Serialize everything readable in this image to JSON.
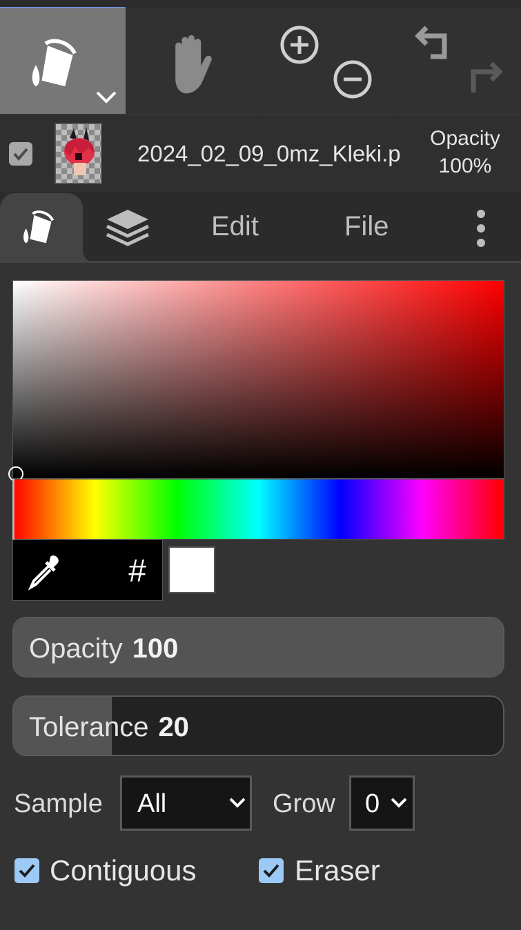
{
  "toolbar": {
    "active_tool": "fill-tool",
    "tools": [
      "fill",
      "hand",
      "zoom",
      "undo-redo"
    ]
  },
  "layer": {
    "visible": true,
    "name": "2024_02_09_0mz_Kleki.p",
    "opacity_label": "Opacity",
    "opacity_value": "100%"
  },
  "tabs": {
    "active": "fill",
    "edit_label": "Edit",
    "file_label": "File"
  },
  "color_picker": {
    "hue_color": "#ff0000",
    "current_color": "#ffffff",
    "hex_label": "#"
  },
  "fill_settings": {
    "opacity_label": "Opacity",
    "opacity_value": "100",
    "opacity_fraction": 1.0,
    "tolerance_label": "Tolerance",
    "tolerance_value": "20",
    "tolerance_fraction": 0.2,
    "sample_label": "Sample",
    "sample_value": "All",
    "grow_label": "Grow",
    "grow_value": "0",
    "contiguous_label": "Contiguous",
    "contiguous_checked": true,
    "eraser_label": "Eraser",
    "eraser_checked": true
  },
  "colors": {
    "accent": "#6f8fd6",
    "checkbox": "#9cc9f5",
    "active_tool_bg": "#777777"
  }
}
